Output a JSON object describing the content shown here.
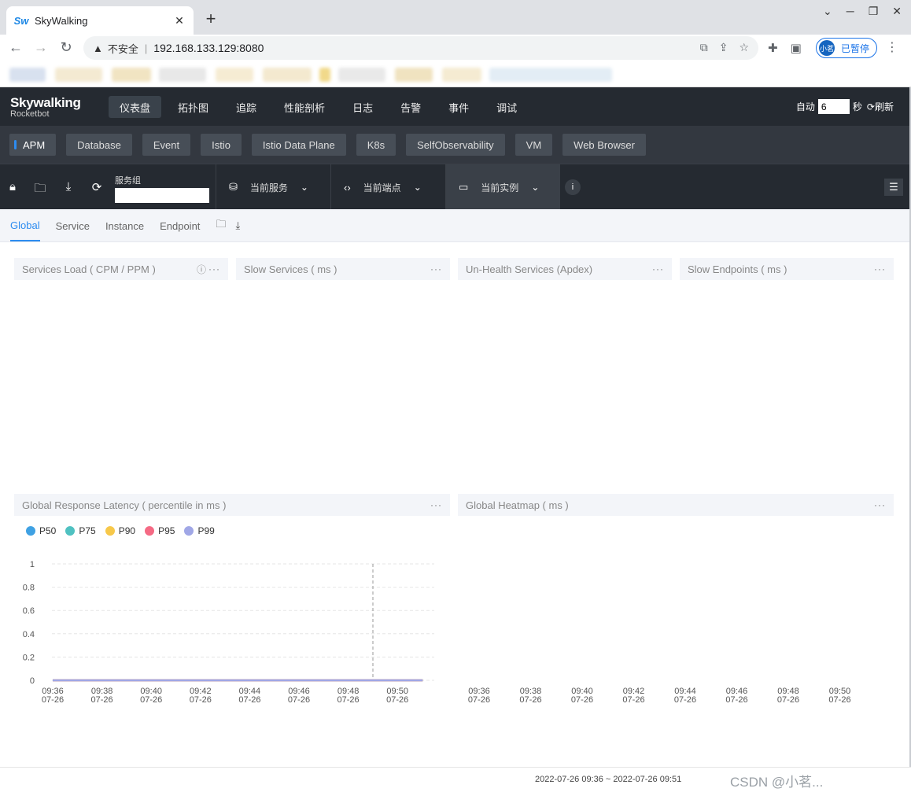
{
  "browser": {
    "tab_title": "SkyWalking",
    "favicon_text": "Sw",
    "new_tab": "+",
    "insecure_label": "不安全",
    "url": "192.168.133.129:8080",
    "profile_avatar": "小茗",
    "profile_status": "已暂停"
  },
  "app": {
    "logo_main": "Skywalking",
    "logo_sub": "Rocketbot",
    "nav": [
      "仪表盘",
      "拓扑图",
      "追踪",
      "性能剖析",
      "日志",
      "告警",
      "事件",
      "调试"
    ],
    "auto_label": "自动",
    "interval": "6",
    "seconds_label": "秒",
    "refresh_label": "刷新"
  },
  "layers": [
    "APM",
    "Database",
    "Event",
    "Istio",
    "Istio Data Plane",
    "K8s",
    "SelfObservability",
    "VM",
    "Web Browser"
  ],
  "selectors": {
    "group_label": "服务组",
    "service_label": "当前服务",
    "endpoint_label": "当前端点",
    "instance_label": "当前实例"
  },
  "page_tabs": [
    "Global",
    "Service",
    "Instance",
    "Endpoint"
  ],
  "widgets": {
    "services_load": "Services Load ( CPM / PPM )",
    "slow_services": "Slow Services ( ms )",
    "unhealth_services": "Un-Health Services (Apdex)",
    "slow_endpoints": "Slow Endpoints ( ms )",
    "global_latency": "Global Response Latency ( percentile in ms )",
    "global_heatmap": "Global Heatmap ( ms )",
    "tools": "···"
  },
  "legend": [
    {
      "name": "P50",
      "color": "#3fa1e3"
    },
    {
      "name": "P75",
      "color": "#4fc1c1"
    },
    {
      "name": "P90",
      "color": "#f7c84a"
    },
    {
      "name": "P95",
      "color": "#f56a84"
    },
    {
      "name": "P99",
      "color": "#a0a7e6"
    }
  ],
  "chart_data": [
    {
      "type": "line",
      "title": "Global Response Latency ( percentile in ms )",
      "x": [
        "09:36\n07-26",
        "09:38\n07-26",
        "09:40\n07-26",
        "09:42\n07-26",
        "09:44\n07-26",
        "09:46\n07-26",
        "09:48\n07-26",
        "09:50\n07-26"
      ],
      "y_ticks": [
        "0",
        "0.2",
        "0.4",
        "0.6",
        "0.8",
        "1"
      ],
      "ylim": [
        0,
        1
      ],
      "series": [
        {
          "name": "P50",
          "values": [
            0,
            0,
            0,
            0,
            0,
            0,
            0,
            0
          ]
        },
        {
          "name": "P75",
          "values": [
            0,
            0,
            0,
            0,
            0,
            0,
            0,
            0
          ]
        },
        {
          "name": "P90",
          "values": [
            0,
            0,
            0,
            0,
            0,
            0,
            0,
            0
          ]
        },
        {
          "name": "P95",
          "values": [
            0,
            0,
            0,
            0,
            0,
            0,
            0,
            0
          ]
        },
        {
          "name": "P99",
          "values": [
            0,
            0,
            0,
            0,
            0,
            0,
            0,
            0
          ]
        }
      ],
      "grid": true,
      "legend": "top-left"
    },
    {
      "type": "heatmap",
      "title": "Global Heatmap ( ms )",
      "x": [
        "09:36\n07-26",
        "09:38\n07-26",
        "09:40\n07-26",
        "09:42\n07-26",
        "09:44\n07-26",
        "09:46\n07-26",
        "09:48\n07-26",
        "09:50\n07-26"
      ]
    }
  ],
  "status": {
    "time_range": "2022-07-26 09:36 ~ 2022-07-26 09:51",
    "watermark": "CSDN @小茗..."
  }
}
